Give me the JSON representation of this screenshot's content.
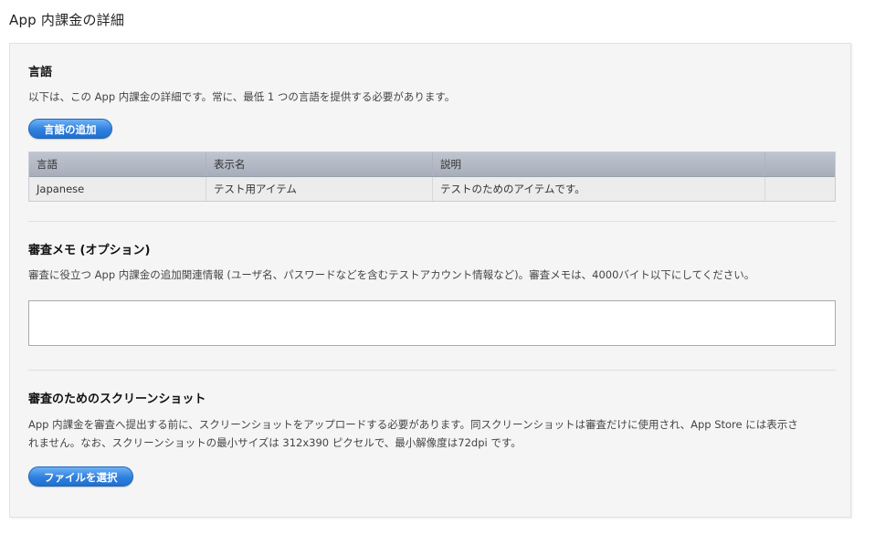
{
  "page": {
    "title": "App 内課金の詳細"
  },
  "languages": {
    "title": "言語",
    "description": "以下は、この App 内課金の詳細です。常に、最低 1 つの言語を提供する必要があります。",
    "add_button": "言語の追加",
    "columns": [
      "言語",
      "表示名",
      "説明",
      ""
    ],
    "rows": [
      {
        "language": "Japanese",
        "display_name": "テスト用アイテム",
        "description": "テストのためのアイテムです。"
      }
    ]
  },
  "review_notes": {
    "title": "審査メモ (オプション)",
    "description": "審査に役立つ App 内課金の追加関連情報 (ユーザ名、パスワードなどを含むテストアカウント情報など)。審査メモは、4000バイト以下にしてください。",
    "value": ""
  },
  "screenshot": {
    "title": "審査のためのスクリーンショット",
    "description_line1": "App 内課金を審査へ提出する前に、スクリーンショットをアップロードする必要があります。同スクリーンショットは審査だけに使用され、App Store には表示さ",
    "description_line2": "れません。なお、スクリーンショットの最小サイズは 312x390 ピクセルで、最小解像度は72dpi です。",
    "choose_button": "ファイルを選択"
  },
  "colors": {
    "button_blue": "#2f80de",
    "panel_bg": "#f5f5f5",
    "table_header": "#b4bac5"
  }
}
